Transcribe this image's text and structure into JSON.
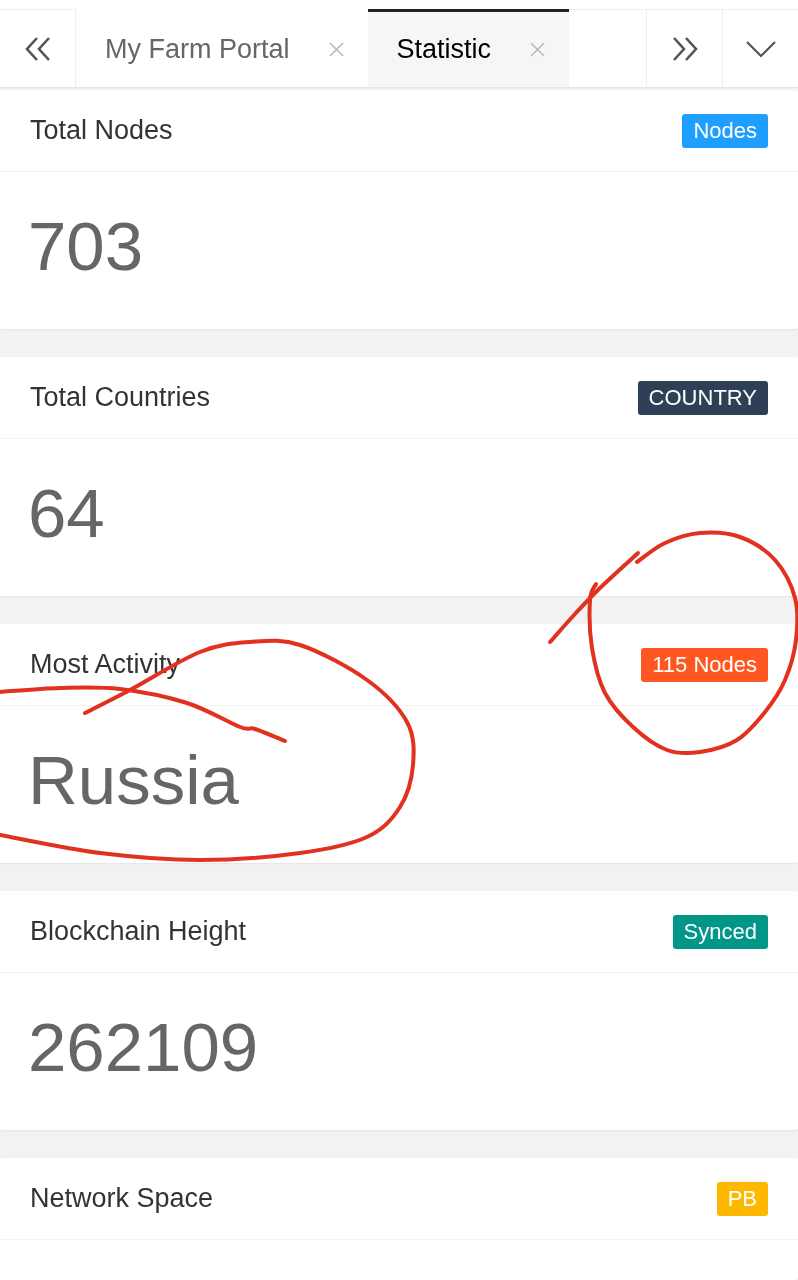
{
  "tabs": [
    {
      "label": "My Farm Portal",
      "selected": false
    },
    {
      "label": "Statistic",
      "selected": true
    }
  ],
  "cards": [
    {
      "title": "Total Nodes",
      "badge": "Nodes",
      "color": "#1e9fff",
      "value": "703"
    },
    {
      "title": "Total Countries",
      "badge": "COUNTRY",
      "color": "#2f4056",
      "value": "64"
    },
    {
      "title": "Most Activity",
      "badge": "115 Nodes",
      "color": "#ff5722",
      "value": "Russia"
    },
    {
      "title": "Blockchain Height",
      "badge": "Synced",
      "color": "#009688",
      "value": "262109"
    },
    {
      "title": "Network Space",
      "badge": "PB",
      "color": "#ffb800"
    }
  ]
}
